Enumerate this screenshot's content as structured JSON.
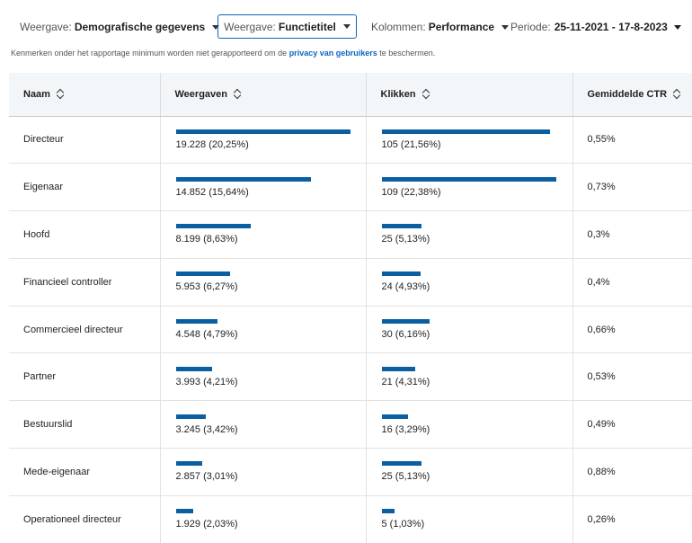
{
  "filters": {
    "view1": {
      "label": "Weergave:",
      "value": "Demografische gegevens"
    },
    "view2": {
      "label": "Weergave:",
      "value": "Functietitel"
    },
    "columns": {
      "label": "Kolommen:",
      "value": "Performance"
    },
    "period": {
      "label": "Periode:",
      "value": "25-11-2021 - 17-8-2023"
    }
  },
  "notice": {
    "text_before": "Kenmerken onder het rapportage minimum worden niet gerapporteerd om de ",
    "link": "privacy van gebruikers",
    "text_after": " te beschermen."
  },
  "table": {
    "headers": {
      "name": "Naam",
      "views": "Weergaven",
      "clicks": "Klikken",
      "ctr": "Gemiddelde CTR"
    },
    "rows": [
      {
        "name": "Directeur",
        "views": "19.228 (20,25%)",
        "views_share": 20.25,
        "clicks": "105 (21,56%)",
        "clicks_share": 21.56,
        "ctr": "0,55%"
      },
      {
        "name": "Eigenaar",
        "views": "14.852 (15,64%)",
        "views_share": 15.64,
        "clicks": "109 (22,38%)",
        "clicks_share": 22.38,
        "ctr": "0,73%"
      },
      {
        "name": "Hoofd",
        "views": "8.199 (8,63%)",
        "views_share": 8.63,
        "clicks": "25 (5,13%)",
        "clicks_share": 5.13,
        "ctr": "0,3%"
      },
      {
        "name": "Financieel controller",
        "views": "5.953 (6,27%)",
        "views_share": 6.27,
        "clicks": "24 (4,93%)",
        "clicks_share": 4.93,
        "ctr": "0,4%"
      },
      {
        "name": "Commercieel directeur",
        "views": "4.548 (4,79%)",
        "views_share": 4.79,
        "clicks": "30 (6,16%)",
        "clicks_share": 6.16,
        "ctr": "0,66%"
      },
      {
        "name": "Partner",
        "views": "3.993 (4,21%)",
        "views_share": 4.21,
        "clicks": "21 (4,31%)",
        "clicks_share": 4.31,
        "ctr": "0,53%"
      },
      {
        "name": "Bestuurslid",
        "views": "3.245 (3,42%)",
        "views_share": 3.42,
        "clicks": "16 (3,29%)",
        "clicks_share": 3.29,
        "ctr": "0,49%"
      },
      {
        "name": "Mede-eigenaar",
        "views": "2.857 (3,01%)",
        "views_share": 3.01,
        "clicks": "25 (5,13%)",
        "clicks_share": 5.13,
        "ctr": "0,88%"
      },
      {
        "name": "Operationeel directeur",
        "views": "1.929 (2,03%)",
        "views_share": 2.03,
        "clicks": "5 (1,03%)",
        "clicks_share": 1.03,
        "ctr": "0,26%"
      }
    ]
  },
  "colors": {
    "bar": "#0a5fa3",
    "link": "#0a66c2",
    "header_bg": "#f3f6f8"
  }
}
